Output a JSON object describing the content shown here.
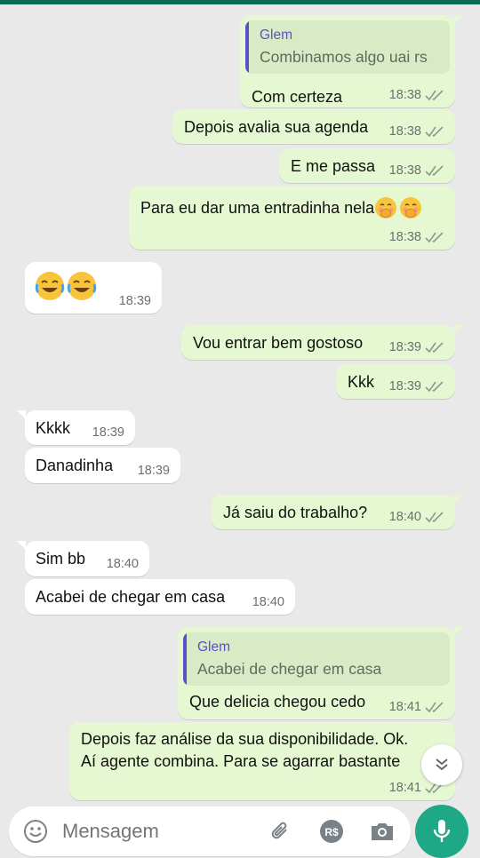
{
  "colors": {
    "outgoing_bubble": "#e6f8d2",
    "incoming_bubble": "#ffffff",
    "accent": "#1ea886",
    "quote_accent": "#5b50c7",
    "read_ticks": "#8c9a8b"
  },
  "messages": [
    {
      "dir": "out",
      "reply_to": {
        "name": "Glem",
        "text": "Combinamos algo uai rs"
      },
      "text": "Com certeza",
      "time": "18:38"
    },
    {
      "dir": "out",
      "text": "Depois avalia sua agenda",
      "time": "18:38"
    },
    {
      "dir": "out",
      "text": "E me passa",
      "time": "18:38"
    },
    {
      "dir": "out",
      "text": "Para eu dar uma entradinha nela",
      "emojis": [
        "face-with-hand-over-mouth-icon",
        "face-with-hand-over-mouth-icon"
      ],
      "time": "18:38"
    },
    {
      "dir": "in",
      "emojis": [
        "face-with-tears-of-joy-icon",
        "face-with-tears-of-joy-icon"
      ],
      "time": "18:39"
    },
    {
      "dir": "out",
      "text": "Vou entrar bem gostoso",
      "time": "18:39"
    },
    {
      "dir": "out",
      "text": "Kkk",
      "time": "18:39"
    },
    {
      "dir": "in",
      "text": "Kkkk",
      "time": "18:39"
    },
    {
      "dir": "in",
      "text": "Danadinha",
      "time": "18:39"
    },
    {
      "dir": "out",
      "text": "Já saiu do trabalho?",
      "time": "18:40"
    },
    {
      "dir": "in",
      "text": "Sim bb",
      "time": "18:40"
    },
    {
      "dir": "in",
      "text": "Acabei de chegar em casa",
      "time": "18:40"
    },
    {
      "dir": "out",
      "reply_to": {
        "name": "Glem",
        "text": "Acabei de chegar em casa"
      },
      "text": "Que delicia chegou cedo",
      "time": "18:41"
    },
    {
      "dir": "out",
      "lines": [
        "Depois faz análise da sua disponibilidade. Ok.",
        "Aí agente combina. Para se agarrar bastante"
      ],
      "time": "18:41"
    }
  ],
  "composer": {
    "placeholder": "Mensagem",
    "icons": [
      "emoji-icon",
      "attach-icon",
      "payment-icon",
      "camera-icon",
      "mic-icon"
    ]
  },
  "scroll_down_icon": "double-chevron-down-icon"
}
